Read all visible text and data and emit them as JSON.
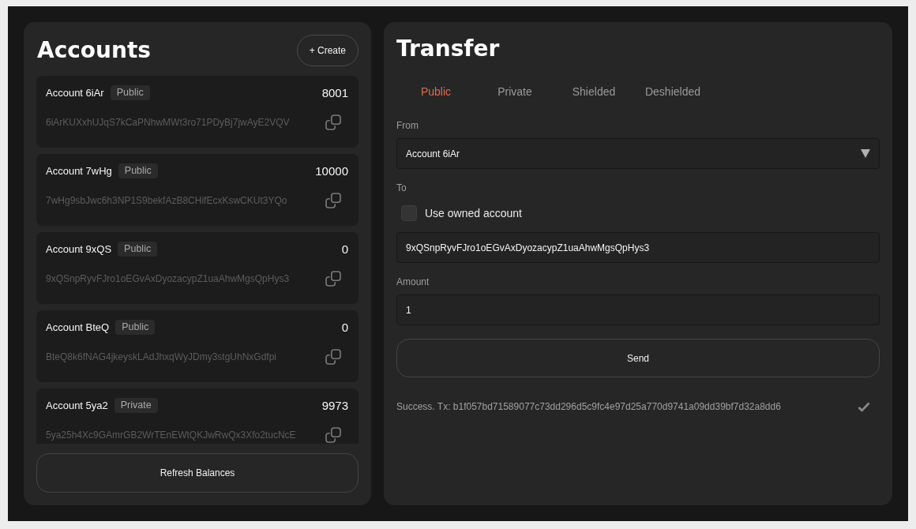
{
  "accounts_panel": {
    "title": "Accounts",
    "create_button": "+ Create",
    "accounts": [
      {
        "name": "Account 6iAr",
        "visibility": "Public",
        "balance": "8001",
        "address": "6iArKUXxhUJqS7kCaPNhwMWt3ro71PDyBj7jwAyE2VQV"
      },
      {
        "name": "Account 7wHg",
        "visibility": "Public",
        "balance": "10000",
        "address": "7wHg9sbJwc6h3NP1S9bekfAzB8CHifEcxKswCKUt3YQo"
      },
      {
        "name": "Account 9xQS",
        "visibility": "Public",
        "balance": "0",
        "address": "9xQSnpRyvFJro1oEGvAxDyozacypZ1uaAhwMgsQpHys3"
      },
      {
        "name": "Account BteQ",
        "visibility": "Public",
        "balance": "0",
        "address": "BteQ8k6fNAG4jkeyskLAdJhxqWyJDmy3stgUhNxGdfpi"
      },
      {
        "name": "Account 5ya2",
        "visibility": "Private",
        "balance": "9973",
        "address": "5ya25h4Xc9GAmrGB2WrTEnEWtQKJwRwQx3Xfo2tucNcE"
      }
    ],
    "refresh_button": "Refresh Balances"
  },
  "transfer_panel": {
    "title": "Transfer",
    "tabs": [
      {
        "label": "Public",
        "selected": true
      },
      {
        "label": "Private",
        "selected": false
      },
      {
        "label": "Shielded",
        "selected": false
      },
      {
        "label": "Deshielded",
        "selected": false
      }
    ],
    "from": {
      "label": "From",
      "value": "Account 6iAr"
    },
    "to": {
      "label": "To",
      "use_owned_account": {
        "label": "Use owned account",
        "checked": false
      },
      "value": "9xQSnpRyvFJro1oEGvAxDyozacypZ1uaAhwMgsQpHys3"
    },
    "amount": {
      "label": "Amount",
      "value": "1"
    },
    "send_button": "Send",
    "status": {
      "kind": "success",
      "text": "Success. Tx: b1f057bd71589077c73dd296d5c9fc4e97d25a770d9741a09dd39bf7d32a8dd6"
    }
  }
}
